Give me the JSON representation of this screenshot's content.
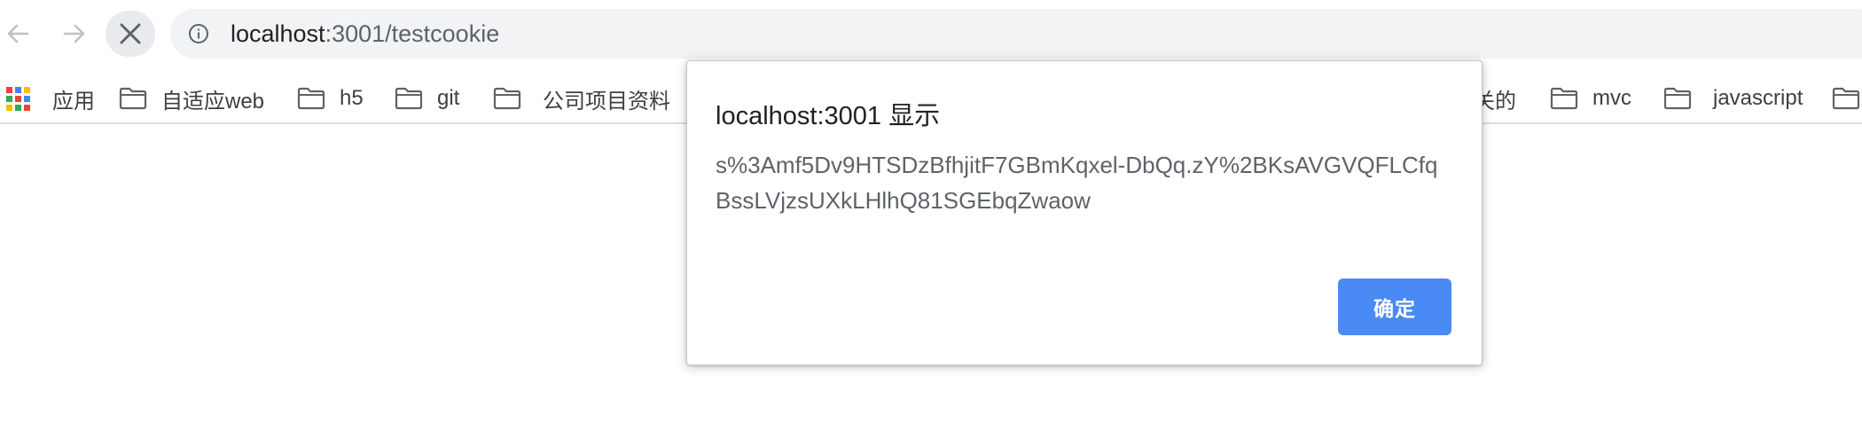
{
  "browser": {
    "url_host": "localhost",
    "url_path": ":3001/testcookie",
    "icons": {
      "back": "arrow-left-icon",
      "forward": "arrow-right-icon",
      "stop": "close-icon",
      "site_info": "info-icon"
    }
  },
  "bookmarks": {
    "items": [
      {
        "label": "应用",
        "icon": "apps-grid-icon"
      },
      {
        "label": "自适应web",
        "icon": "folder-icon"
      },
      {
        "label": "h5",
        "icon": "folder-icon"
      },
      {
        "label": "git",
        "icon": "folder-icon"
      },
      {
        "label": "公司项目资料",
        "icon": "folder-icon"
      },
      {
        "label": "关的",
        "icon": ""
      },
      {
        "label": "mvc",
        "icon": "folder-icon"
      },
      {
        "label": "javascript",
        "icon": "folder-icon"
      },
      {
        "label": "",
        "icon": "folder-icon"
      }
    ]
  },
  "dialog": {
    "title": "localhost:3001 显示",
    "message": "s%3Amf5Dv9HTSDzBfhjitF7GBmKqxel-DbQq.zY%2BKsAVGVQFLCfqBssLVjzsUXkLHlhQ81SGEbqZwaow",
    "ok_label": "确定"
  },
  "colors": {
    "accent": "#4a8af4",
    "omnibox_bg": "#f1f3f4",
    "stop_bg": "#e8eaed",
    "text_primary": "#202124",
    "text_secondary": "#5f6368"
  }
}
